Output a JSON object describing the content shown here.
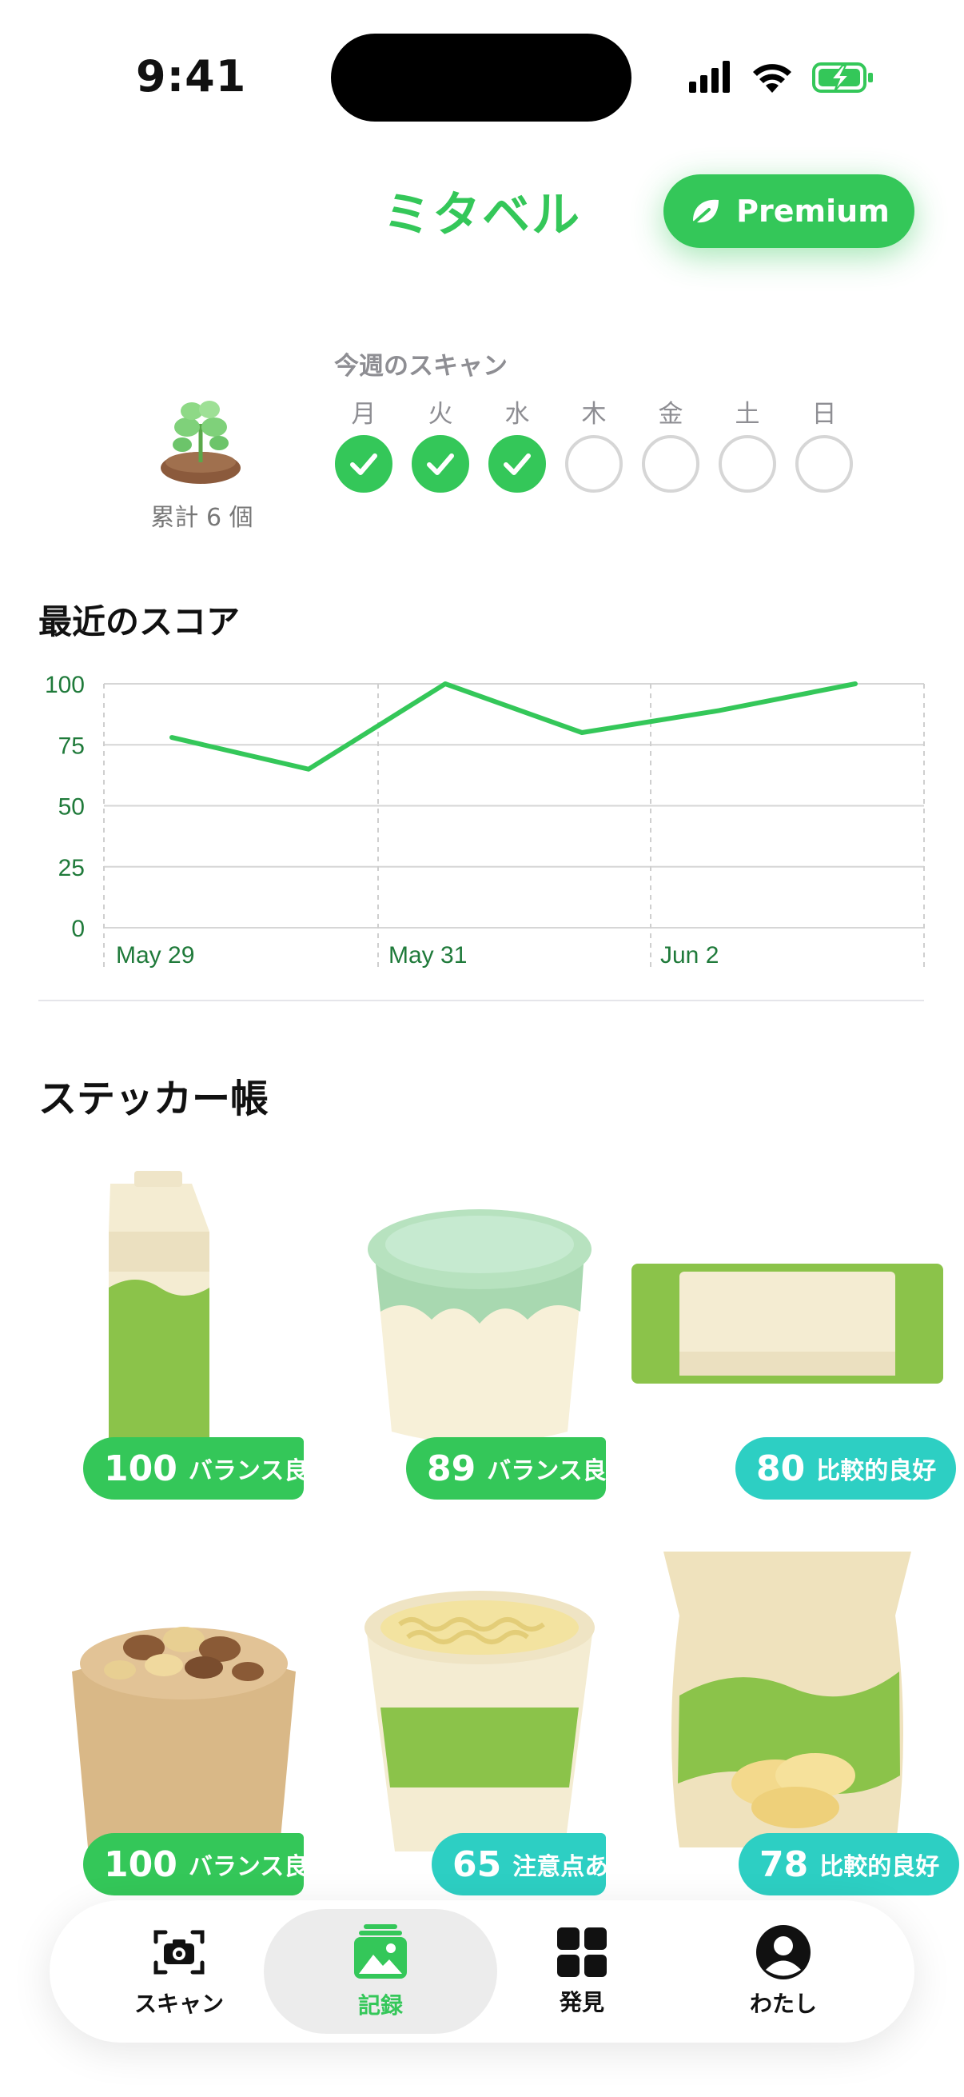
{
  "status": {
    "time": "9:41"
  },
  "header": {
    "title": "ミタベル",
    "premium_label": "Premium"
  },
  "weekly": {
    "title": "今週のスキャン",
    "total_label": "累計 6 個",
    "days": [
      {
        "label": "月",
        "done": true
      },
      {
        "label": "火",
        "done": true
      },
      {
        "label": "水",
        "done": true
      },
      {
        "label": "木",
        "done": false
      },
      {
        "label": "金",
        "done": false
      },
      {
        "label": "土",
        "done": false
      },
      {
        "label": "日",
        "done": false
      }
    ]
  },
  "chart_section": {
    "title": "最近のスコア"
  },
  "chart_data": {
    "type": "line",
    "x": [
      "May 29",
      "May 30",
      "May 31",
      "Jun 1",
      "Jun 2",
      "Jun 3"
    ],
    "values": [
      78,
      65,
      100,
      80,
      89,
      100
    ],
    "xticks": [
      "May 29",
      "May 31",
      "Jun 2"
    ],
    "yticks": [
      "100",
      "75",
      "50",
      "25",
      "0"
    ],
    "ylim": [
      0,
      100
    ],
    "grid": true,
    "line_color": "#34C759"
  },
  "stickers": {
    "title": "ステッカー帳",
    "items": [
      {
        "product": "milk-carton",
        "score": "100",
        "label": "バランス良",
        "color": "green"
      },
      {
        "product": "yogurt-cup",
        "score": "89",
        "label": "バランス良",
        "color": "green"
      },
      {
        "product": "snack-bar",
        "score": "80",
        "label": "比較的良好",
        "color": "teal"
      },
      {
        "product": "nuts-bag",
        "score": "100",
        "label": "バランス良",
        "color": "green"
      },
      {
        "product": "noodle-cup",
        "score": "65",
        "label": "注意点あ",
        "color": "teal"
      },
      {
        "product": "chips-bag",
        "score": "78",
        "label": "比較的良好",
        "color": "teal"
      }
    ]
  },
  "nav": {
    "items": [
      {
        "label": "スキャン",
        "icon": "camera-icon"
      },
      {
        "label": "記録",
        "icon": "photo-stack-icon",
        "active": true
      },
      {
        "label": "発見",
        "icon": "grid-icon"
      },
      {
        "label": "わたし",
        "icon": "person-icon"
      }
    ]
  },
  "colors": {
    "accent": "#34C759",
    "teal": "#2DCFC3"
  }
}
